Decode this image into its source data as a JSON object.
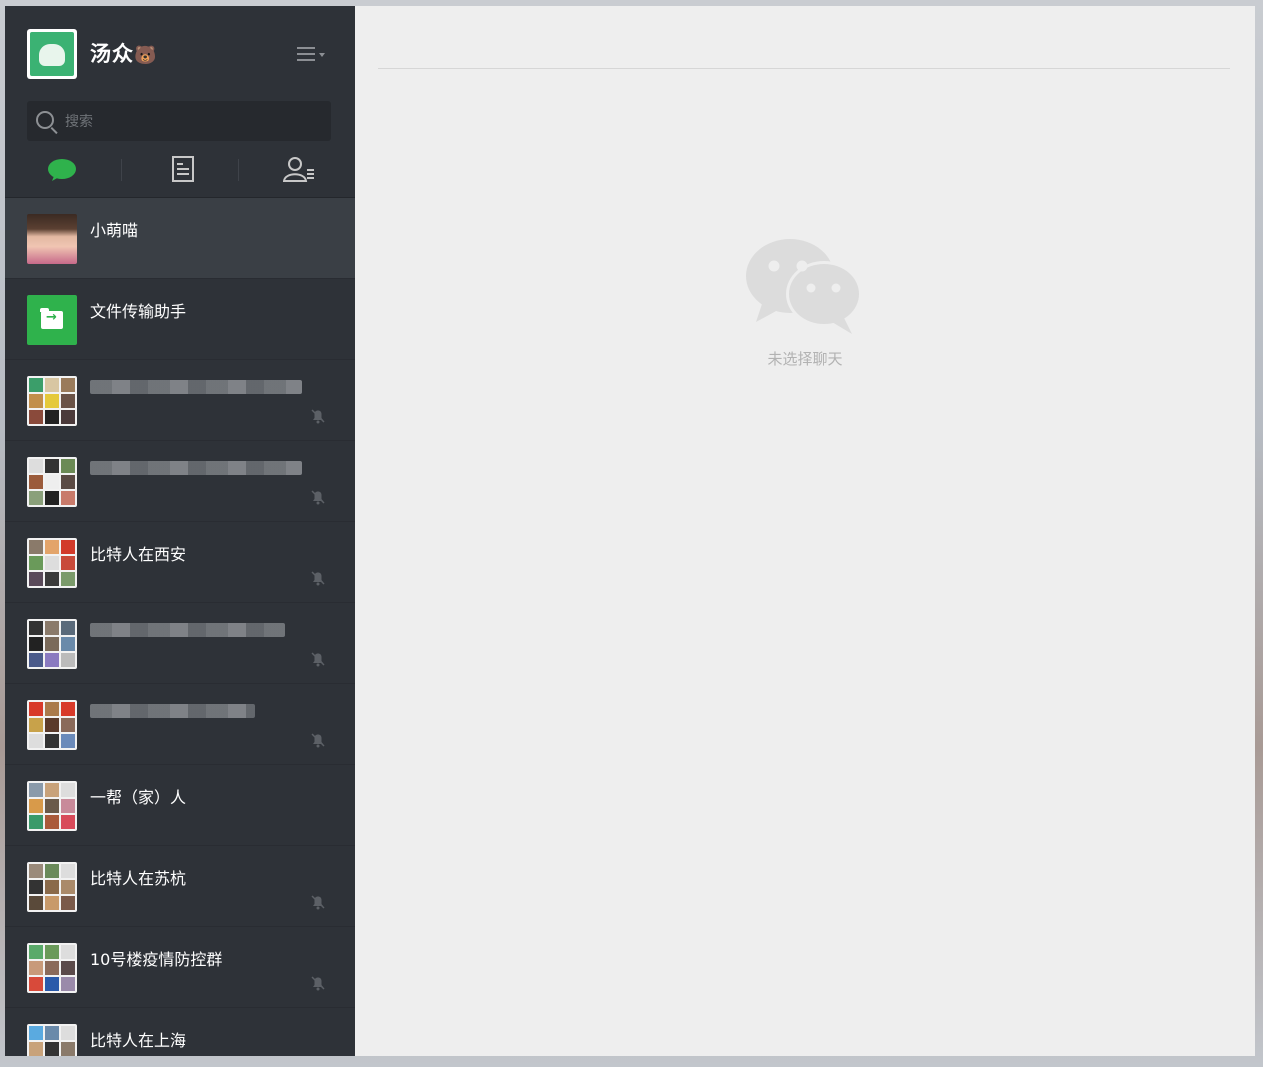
{
  "profile": {
    "name": "汤众",
    "emoji": "🐻"
  },
  "search": {
    "placeholder": "搜索"
  },
  "chats": [
    {
      "name": "小萌喵"
    },
    {
      "name": "文件传输助手"
    },
    {
      "name": ""
    },
    {
      "name": ""
    },
    {
      "name": "比特人在西安"
    },
    {
      "name": ""
    },
    {
      "name": ""
    },
    {
      "name": "一帮（家）人"
    },
    {
      "name": "比特人在苏杭"
    },
    {
      "name": "10号楼疫情防控群"
    },
    {
      "name": "比特人在上海"
    }
  ],
  "main": {
    "empty_text": "未选择聊天"
  },
  "colors": {
    "sidebar": "#2e3238",
    "accent_green": "#2fb24c",
    "main_bg": "#eeeeee"
  }
}
